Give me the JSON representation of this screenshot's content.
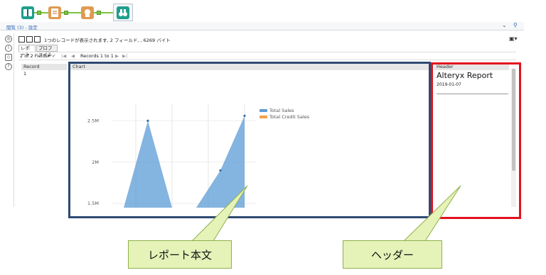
{
  "results": {
    "title": "閲覧 (3) - 設定",
    "summary": "1つのレコードが表示されます, 2 フィールド, , 6269 バイト",
    "tabs": [
      "レポート",
      "プロファイル"
    ],
    "field_selector": "2 of 2 Fields",
    "records": "Records 1 to 1",
    "columns": {
      "record": "Record",
      "chart": "Chart",
      "header": "Header"
    },
    "record_value": "1"
  },
  "header_panel": {
    "title": "Alteryx Report",
    "date": "2019-01-07"
  },
  "chart_data": {
    "type": "area",
    "title": "",
    "xlabel": "",
    "ylabel": "",
    "ytick_labels": [
      "2.5M",
      "2M",
      "1.5M"
    ],
    "yticks": [
      2500000,
      2000000,
      1500000
    ],
    "ylim": [
      1450000,
      2700000
    ],
    "legend_placement": "right",
    "grid": true,
    "series": [
      {
        "name": "Total Sales",
        "color": "#5b9bd5",
        "points": [
          {
            "x": 1,
            "y": 1450000
          },
          {
            "x": 2,
            "y": 2500000
          },
          {
            "x": 3,
            "y": 1450000
          },
          {
            "x": 4,
            "y": 1450000
          },
          {
            "x": 5,
            "y": 1900000
          },
          {
            "x": 6,
            "y": 2560000
          }
        ]
      },
      {
        "name": "Total Credit Sales",
        "color": "#f5a04a",
        "points": []
      }
    ]
  },
  "annotations": {
    "body_label": "レポート本文",
    "header_label": "ヘッダー",
    "body_color": "#2f4a73",
    "header_color": "#e3131d",
    "callout_fill": "#e5f2b8"
  },
  "icons": [
    "input-data-icon",
    "report-text-icon",
    "report-header-icon",
    "browse-icon",
    "search-icon",
    "chevron-down-icon",
    "layout-icon",
    "info-icon",
    "tag-icon",
    "help-icon",
    "first-page-icon",
    "prev-page-icon",
    "next-page-icon",
    "last-page-icon",
    "checkmark-icon"
  ]
}
